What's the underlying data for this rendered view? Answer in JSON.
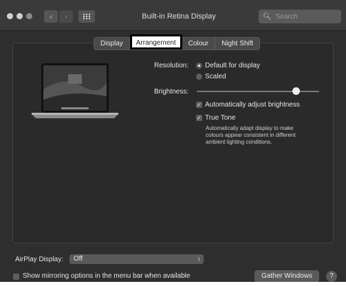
{
  "window": {
    "title": "Built-in Retina Display",
    "search_placeholder": "Search",
    "back_icon": "chevron-left-icon",
    "forward_icon": "chevron-right-icon",
    "grid_icon": "grid-icon"
  },
  "tabs": [
    {
      "label": "Display",
      "selected": false
    },
    {
      "label": "Arrangement",
      "selected": true
    },
    {
      "label": "Colour",
      "selected": false
    },
    {
      "label": "Night Shift",
      "selected": false
    }
  ],
  "resolution": {
    "label": "Resolution:",
    "options": [
      {
        "label": "Default for display",
        "selected": true
      },
      {
        "label": "Scaled",
        "selected": false
      }
    ]
  },
  "brightness": {
    "label": "Brightness:",
    "level": 0.81,
    "auto_label": "Automatically adjust brightness",
    "auto_checked": true
  },
  "true_tone": {
    "label": "True Tone",
    "checked": true,
    "description": "Automatically adapt display to make colours appear consistent in different ambient lighting conditions."
  },
  "airplay": {
    "label": "AirPlay Display:",
    "value": "Off"
  },
  "mirroring": {
    "label": "Show mirroring options in the menu bar when available",
    "checked": false
  },
  "buttons": {
    "gather": "Gather Windows",
    "help": "?"
  },
  "colors": {
    "window_bg": "#2e2e2e",
    "selected_tab_highlight": "#ffffff"
  }
}
